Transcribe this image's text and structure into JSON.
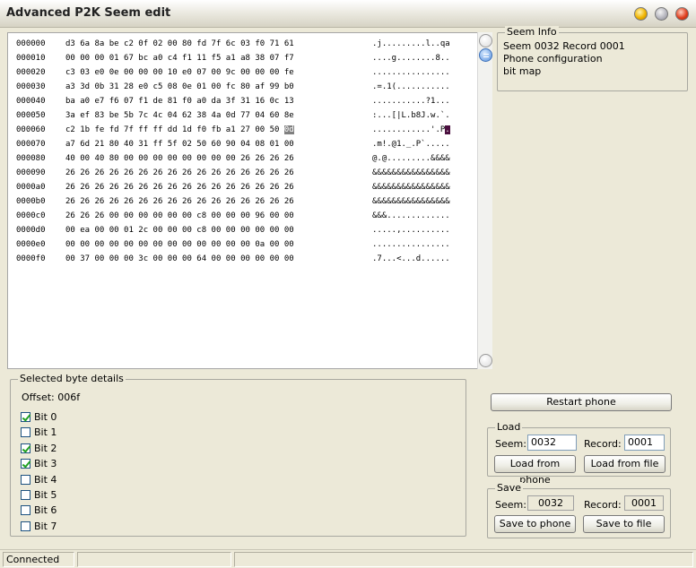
{
  "window": {
    "title": "Advanced P2K Seem edit"
  },
  "hex": {
    "rows": [
      {
        "offset": "000000",
        "bytes": "d3 6a 8a be c2 0f 02 00 80 fd 7f 6c 03 f0 71 61",
        "ascii": ".j.........l..qa"
      },
      {
        "offset": "000010",
        "bytes": "00 00 00 01 67 bc a0 c4 f1 11 f5 a1 a8 38 07 f7",
        "ascii": "....g........8.."
      },
      {
        "offset": "000020",
        "bytes": "c3 03 e0 0e 00 00 00 10 e0 07 00 9c 00 00 00 fe",
        "ascii": "................"
      },
      {
        "offset": "000030",
        "bytes": "a3 3d 0b 31 28 e0 c5 08 0e 01 00 fc 80 af 99 b0",
        "ascii": ".=.1(..........."
      },
      {
        "offset": "000040",
        "bytes": "ba a0 e7 f6 07 f1 de 81 f0 a0 da 3f 31 16 0c 13",
        "ascii": "...........?1..."
      },
      {
        "offset": "000050",
        "bytes": "3a ef 83 be 5b 7c 4c 04 62 38 4a 0d 77 04 60 8e",
        "ascii": ":...[|L.b8J.w.`."
      },
      {
        "offset": "000060",
        "bytes": "c2 1b fe fd 7f ff ff dd 1d f0 fb a1 27 00 50 ",
        "selbyte": "0d",
        "ascii": "............'.P",
        "selascii": "."
      },
      {
        "offset": "000070",
        "bytes": "a7 6d 21 80 40 31 ff 5f 02 50 60 90 04 08 01 00",
        "ascii": ".m!.@1._.P`....."
      },
      {
        "offset": "000080",
        "bytes": "40 00 40 80 00 00 00 00 00 00 00 00 26 26 26 26",
        "ascii": "@.@.........&&&&"
      },
      {
        "offset": "000090",
        "bytes": "26 26 26 26 26 26 26 26 26 26 26 26 26 26 26 26",
        "ascii": "&&&&&&&&&&&&&&&&"
      },
      {
        "offset": "0000a0",
        "bytes": "26 26 26 26 26 26 26 26 26 26 26 26 26 26 26 26",
        "ascii": "&&&&&&&&&&&&&&&&"
      },
      {
        "offset": "0000b0",
        "bytes": "26 26 26 26 26 26 26 26 26 26 26 26 26 26 26 26",
        "ascii": "&&&&&&&&&&&&&&&&"
      },
      {
        "offset": "0000c0",
        "bytes": "26 26 26 00 00 00 00 00 00 c8 00 00 00 96 00 00",
        "ascii": "&&&............."
      },
      {
        "offset": "0000d0",
        "bytes": "00 ea 00 00 01 2c 00 00 00 c8 00 00 00 00 00 00",
        "ascii": ".....,.........."
      },
      {
        "offset": "0000e0",
        "bytes": "00 00 00 00 00 00 00 00 00 00 00 00 00 0a 00 00",
        "ascii": "................"
      },
      {
        "offset": "0000f0",
        "bytes": "00 37 00 00 00 3c 00 00 00 64 00 00 00 00 00 00",
        "ascii": ".7...<...d......"
      }
    ]
  },
  "seem_info": {
    "legend": "Seem Info",
    "line1": "Seem 0032 Record 0001",
    "line2": "Phone configuration",
    "line3": "bit map"
  },
  "byte_details": {
    "legend": "Selected byte details",
    "offset_text": "Offset: 006f",
    "bits": [
      {
        "label": "Bit 0",
        "checked": true
      },
      {
        "label": "Bit 1",
        "checked": false
      },
      {
        "label": "Bit 2",
        "checked": true
      },
      {
        "label": "Bit 3",
        "checked": true
      },
      {
        "label": "Bit 4",
        "checked": false
      },
      {
        "label": "Bit 5",
        "checked": false
      },
      {
        "label": "Bit 6",
        "checked": false
      },
      {
        "label": "Bit 7",
        "checked": false
      }
    ]
  },
  "restart_label": "Restart phone",
  "load": {
    "legend": "Load",
    "seem_label": "Seem:",
    "seem_value": "0032",
    "record_label": "Record:",
    "record_value": "0001",
    "from_phone_label": "Load from phone",
    "from_file_label": "Load from file"
  },
  "save": {
    "legend": "Save",
    "seem_label": "Seem:",
    "seem_value": "0032",
    "record_label": "Record:",
    "record_value": "0001",
    "to_phone_label": "Save to phone",
    "to_file_label": "Save to file"
  },
  "status": {
    "text": "Connected"
  },
  "colors": {
    "selected_byte": "#808080",
    "selected_ascii": "#4b0f3f",
    "check": "#21a121"
  }
}
